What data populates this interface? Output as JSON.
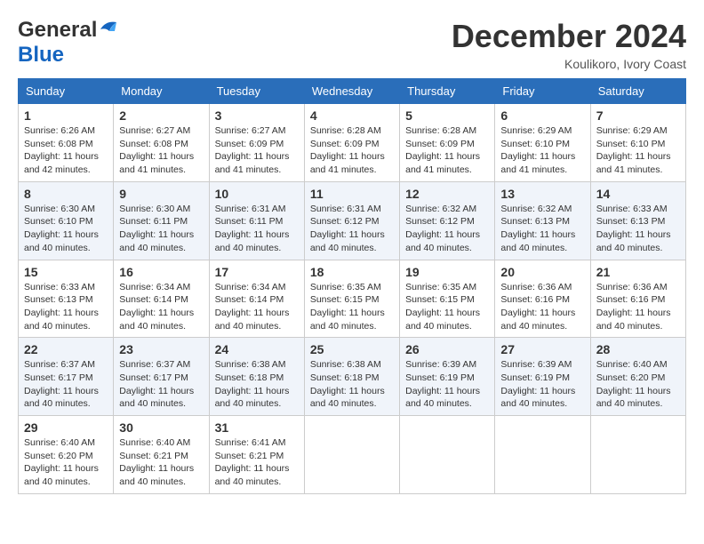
{
  "header": {
    "logo_general": "General",
    "logo_blue": "Blue",
    "month": "December 2024",
    "location": "Koulikoro, Ivory Coast"
  },
  "days_of_week": [
    "Sunday",
    "Monday",
    "Tuesday",
    "Wednesday",
    "Thursday",
    "Friday",
    "Saturday"
  ],
  "weeks": [
    [
      {
        "day": "1",
        "sunrise": "6:26 AM",
        "sunset": "6:08 PM",
        "daylight": "11 hours and 42 minutes."
      },
      {
        "day": "2",
        "sunrise": "6:27 AM",
        "sunset": "6:08 PM",
        "daylight": "11 hours and 41 minutes."
      },
      {
        "day": "3",
        "sunrise": "6:27 AM",
        "sunset": "6:09 PM",
        "daylight": "11 hours and 41 minutes."
      },
      {
        "day": "4",
        "sunrise": "6:28 AM",
        "sunset": "6:09 PM",
        "daylight": "11 hours and 41 minutes."
      },
      {
        "day": "5",
        "sunrise": "6:28 AM",
        "sunset": "6:09 PM",
        "daylight": "11 hours and 41 minutes."
      },
      {
        "day": "6",
        "sunrise": "6:29 AM",
        "sunset": "6:10 PM",
        "daylight": "11 hours and 41 minutes."
      },
      {
        "day": "7",
        "sunrise": "6:29 AM",
        "sunset": "6:10 PM",
        "daylight": "11 hours and 41 minutes."
      }
    ],
    [
      {
        "day": "8",
        "sunrise": "6:30 AM",
        "sunset": "6:10 PM",
        "daylight": "11 hours and 40 minutes."
      },
      {
        "day": "9",
        "sunrise": "6:30 AM",
        "sunset": "6:11 PM",
        "daylight": "11 hours and 40 minutes."
      },
      {
        "day": "10",
        "sunrise": "6:31 AM",
        "sunset": "6:11 PM",
        "daylight": "11 hours and 40 minutes."
      },
      {
        "day": "11",
        "sunrise": "6:31 AM",
        "sunset": "6:12 PM",
        "daylight": "11 hours and 40 minutes."
      },
      {
        "day": "12",
        "sunrise": "6:32 AM",
        "sunset": "6:12 PM",
        "daylight": "11 hours and 40 minutes."
      },
      {
        "day": "13",
        "sunrise": "6:32 AM",
        "sunset": "6:13 PM",
        "daylight": "11 hours and 40 minutes."
      },
      {
        "day": "14",
        "sunrise": "6:33 AM",
        "sunset": "6:13 PM",
        "daylight": "11 hours and 40 minutes."
      }
    ],
    [
      {
        "day": "15",
        "sunrise": "6:33 AM",
        "sunset": "6:13 PM",
        "daylight": "11 hours and 40 minutes."
      },
      {
        "day": "16",
        "sunrise": "6:34 AM",
        "sunset": "6:14 PM",
        "daylight": "11 hours and 40 minutes."
      },
      {
        "day": "17",
        "sunrise": "6:34 AM",
        "sunset": "6:14 PM",
        "daylight": "11 hours and 40 minutes."
      },
      {
        "day": "18",
        "sunrise": "6:35 AM",
        "sunset": "6:15 PM",
        "daylight": "11 hours and 40 minutes."
      },
      {
        "day": "19",
        "sunrise": "6:35 AM",
        "sunset": "6:15 PM",
        "daylight": "11 hours and 40 minutes."
      },
      {
        "day": "20",
        "sunrise": "6:36 AM",
        "sunset": "6:16 PM",
        "daylight": "11 hours and 40 minutes."
      },
      {
        "day": "21",
        "sunrise": "6:36 AM",
        "sunset": "6:16 PM",
        "daylight": "11 hours and 40 minutes."
      }
    ],
    [
      {
        "day": "22",
        "sunrise": "6:37 AM",
        "sunset": "6:17 PM",
        "daylight": "11 hours and 40 minutes."
      },
      {
        "day": "23",
        "sunrise": "6:37 AM",
        "sunset": "6:17 PM",
        "daylight": "11 hours and 40 minutes."
      },
      {
        "day": "24",
        "sunrise": "6:38 AM",
        "sunset": "6:18 PM",
        "daylight": "11 hours and 40 minutes."
      },
      {
        "day": "25",
        "sunrise": "6:38 AM",
        "sunset": "6:18 PM",
        "daylight": "11 hours and 40 minutes."
      },
      {
        "day": "26",
        "sunrise": "6:39 AM",
        "sunset": "6:19 PM",
        "daylight": "11 hours and 40 minutes."
      },
      {
        "day": "27",
        "sunrise": "6:39 AM",
        "sunset": "6:19 PM",
        "daylight": "11 hours and 40 minutes."
      },
      {
        "day": "28",
        "sunrise": "6:40 AM",
        "sunset": "6:20 PM",
        "daylight": "11 hours and 40 minutes."
      }
    ],
    [
      {
        "day": "29",
        "sunrise": "6:40 AM",
        "sunset": "6:20 PM",
        "daylight": "11 hours and 40 minutes."
      },
      {
        "day": "30",
        "sunrise": "6:40 AM",
        "sunset": "6:21 PM",
        "daylight": "11 hours and 40 minutes."
      },
      {
        "day": "31",
        "sunrise": "6:41 AM",
        "sunset": "6:21 PM",
        "daylight": "11 hours and 40 minutes."
      },
      null,
      null,
      null,
      null
    ]
  ],
  "labels": {
    "sunrise": "Sunrise:",
    "sunset": "Sunset:",
    "daylight": "Daylight:"
  }
}
